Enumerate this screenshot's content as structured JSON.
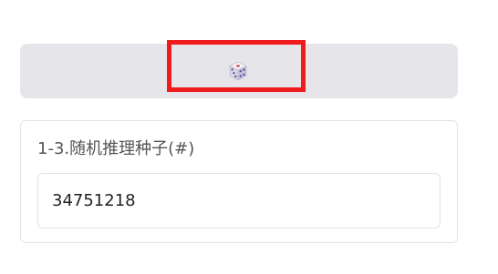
{
  "dice_button": {
    "icon": "dice-icon"
  },
  "seed_field": {
    "label": "1-3.随机推理种子(#)",
    "value": "34751218"
  },
  "colors": {
    "button_bg": "#e6e5ea",
    "highlight": "#ee1c1c",
    "dice_pip_red": "#d8383e",
    "dice_pip_purple": "#5a3d9a"
  }
}
